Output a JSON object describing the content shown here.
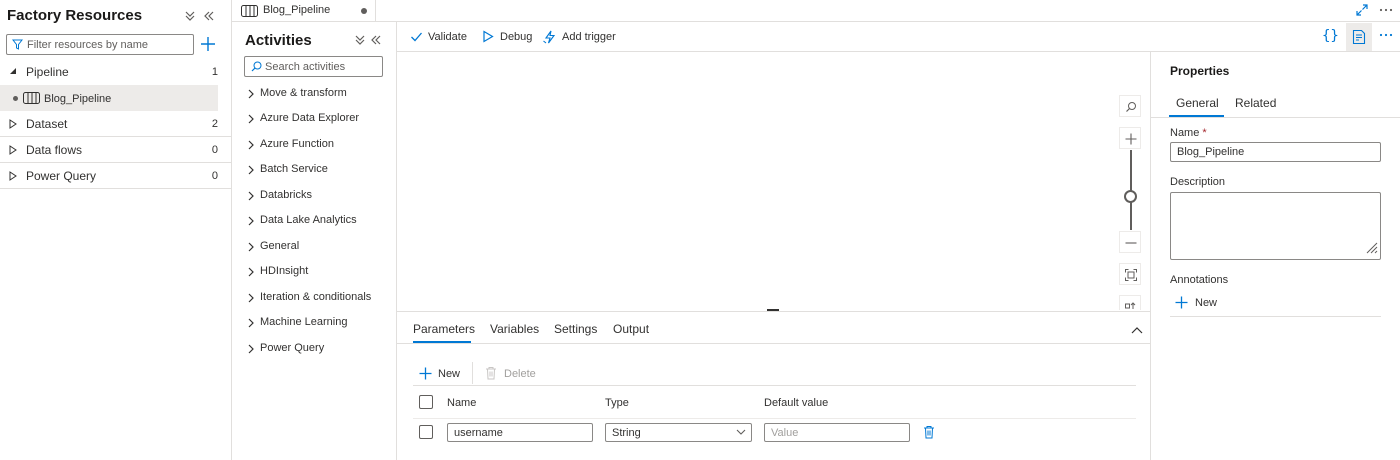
{
  "factory_resources": {
    "title": "Factory Resources",
    "filter_placeholder": "Filter resources by name",
    "items": [
      {
        "label": "Pipeline",
        "count": "1",
        "expanded": true
      },
      {
        "label": "Dataset",
        "count": "2",
        "expanded": false
      },
      {
        "label": "Data flows",
        "count": "0",
        "expanded": false
      },
      {
        "label": "Power Query",
        "count": "0",
        "expanded": false
      }
    ],
    "pipelines": [
      {
        "label": "Blog_Pipeline"
      }
    ]
  },
  "tab": {
    "label": "Blog_Pipeline"
  },
  "activities": {
    "title": "Activities",
    "search_placeholder": "Search activities",
    "items": [
      "Move & transform",
      "Azure Data Explorer",
      "Azure Function",
      "Batch Service",
      "Databricks",
      "Data Lake Analytics",
      "General",
      "HDInsight",
      "Iteration & conditionals",
      "Machine Learning",
      "Power Query"
    ]
  },
  "toolbar": {
    "validate": "Validate",
    "debug": "Debug",
    "add_trigger": "Add trigger",
    "code_glyph": "{}"
  },
  "bottom_panel": {
    "tabs": [
      "Parameters",
      "Variables",
      "Settings",
      "Output"
    ],
    "active_tab": "Parameters",
    "new_label": "New",
    "delete_label": "Delete",
    "columns": {
      "name": "Name",
      "type": "Type",
      "default": "Default value"
    },
    "rows": [
      {
        "name": "username",
        "type": "String",
        "default_placeholder": "Value"
      }
    ]
  },
  "properties": {
    "title": "Properties",
    "tabs": {
      "general": "General",
      "related": "Related"
    },
    "name_label": "Name",
    "required_mark": "*",
    "name_value": "Blog_Pipeline",
    "description_label": "Description",
    "annotations_label": "Annotations",
    "annotations_new": "New"
  },
  "colors": {
    "accent": "#0078d4",
    "selected_bg": "#edebe9",
    "border": "#e1dfdd"
  }
}
